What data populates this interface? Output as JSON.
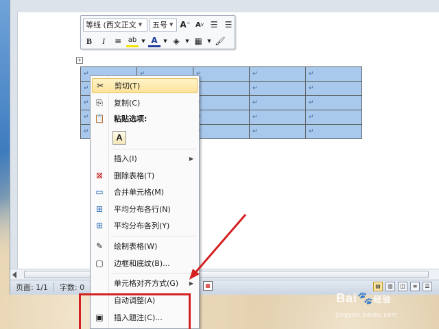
{
  "mini_toolbar": {
    "font_name": "等线 (西文正文",
    "font_size": "五号",
    "bold_label": "B",
    "italic_label": "I",
    "font_color_label": "A"
  },
  "table": {
    "cell_mark": "↵",
    "rows": 5,
    "cols": 5
  },
  "context_menu": {
    "items": [
      {
        "label": "剪切(T)",
        "icon": "scissors-icon"
      },
      {
        "label": "复制(C)",
        "icon": "copy-icon"
      },
      {
        "label": "粘贴选项:",
        "icon": "clipboard-icon"
      },
      {
        "label": "A",
        "icon": "paste-keep-text-icon"
      },
      {
        "label": "插入(I)",
        "icon": ""
      },
      {
        "label": "删除表格(T)",
        "icon": "delete-table-icon"
      },
      {
        "label": "合并单元格(M)",
        "icon": "merge-cells-icon"
      },
      {
        "label": "平均分布各行(N)",
        "icon": "distribute-rows-icon"
      },
      {
        "label": "平均分布各列(Y)",
        "icon": "distribute-columns-icon"
      },
      {
        "label": "绘制表格(W)",
        "icon": "draw-table-icon"
      },
      {
        "label": "边框和底纹(B)...",
        "icon": "borders-shading-icon"
      },
      {
        "label": "单元格对齐方式(G)",
        "icon": ""
      },
      {
        "label": "自动调整(A)",
        "icon": ""
      },
      {
        "label": "插入题注(C)...",
        "icon": "insert-caption-icon"
      }
    ]
  },
  "status_bar": {
    "page": "页面: 1/1",
    "words": "字数: 0"
  },
  "watermark": {
    "brand": "Bai",
    "brand2": "经验",
    "url": "jingyan.baidu.com"
  },
  "colors": {
    "table_selection": "#a8c8ec",
    "menu_highlight": "#fde39a",
    "annotation_red": "#d42020"
  }
}
